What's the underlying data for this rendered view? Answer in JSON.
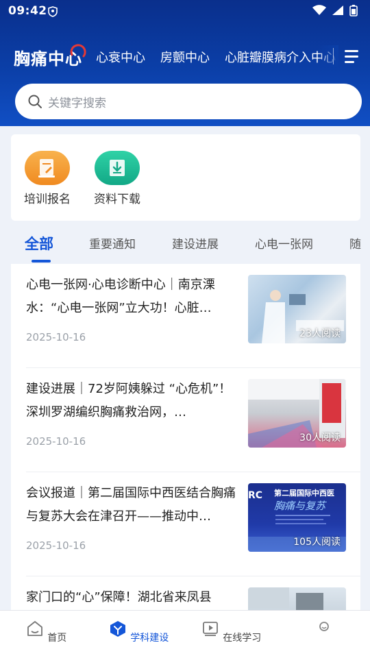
{
  "status_bar": {
    "time": "09:42"
  },
  "brand": {
    "title": "胸痛中心"
  },
  "top_nav": [
    "心衰中心",
    "房颤中心",
    "心脏瓣膜病介入中心"
  ],
  "search": {
    "placeholder": "关键字搜索"
  },
  "quick_actions": [
    {
      "label": "培训报名",
      "icon": "signup-doc-icon",
      "color": "#f59a2e"
    },
    {
      "label": "资料下载",
      "icon": "download-icon",
      "color": "#19b993"
    }
  ],
  "tabs": [
    {
      "label": "全部",
      "active": true
    },
    {
      "label": "重要通知",
      "active": false
    },
    {
      "label": "建设进展",
      "active": false
    },
    {
      "label": "心电一张网",
      "active": false
    },
    {
      "label": "随",
      "active": false
    }
  ],
  "articles": [
    {
      "title": "心电一张网·心电诊断中心｜南京溧水：“心电一张网”立大功！心脏…",
      "date": "2025-10-16",
      "reads": "23人阅读"
    },
    {
      "title": "建设进展｜72岁阿姨躲过 “心危机”！ 深圳罗湖编织胸痛救治网，…",
      "date": "2025-10-16",
      "reads": "30人阅读"
    },
    {
      "title": "会议报道｜第二届国际中西医结合胸痛与复苏大会在津召开——推动中…",
      "date": "2025-10-16",
      "reads": "105人阅读"
    },
    {
      "title": "家门口的“心”保障！湖北省来凤县",
      "date": "",
      "reads": ""
    }
  ],
  "thumb_text": {
    "banner_left": "RC",
    "banner_title": "第二届国际中西医",
    "banner_sub": "胸痛与复苏"
  },
  "bottom_nav": [
    {
      "label": "首页",
      "active": false
    },
    {
      "label": "学科建设",
      "active": true
    },
    {
      "label": "在线学习",
      "active": false
    }
  ],
  "colors": {
    "accent": "#1456d8",
    "header": "#0b3fa8"
  }
}
